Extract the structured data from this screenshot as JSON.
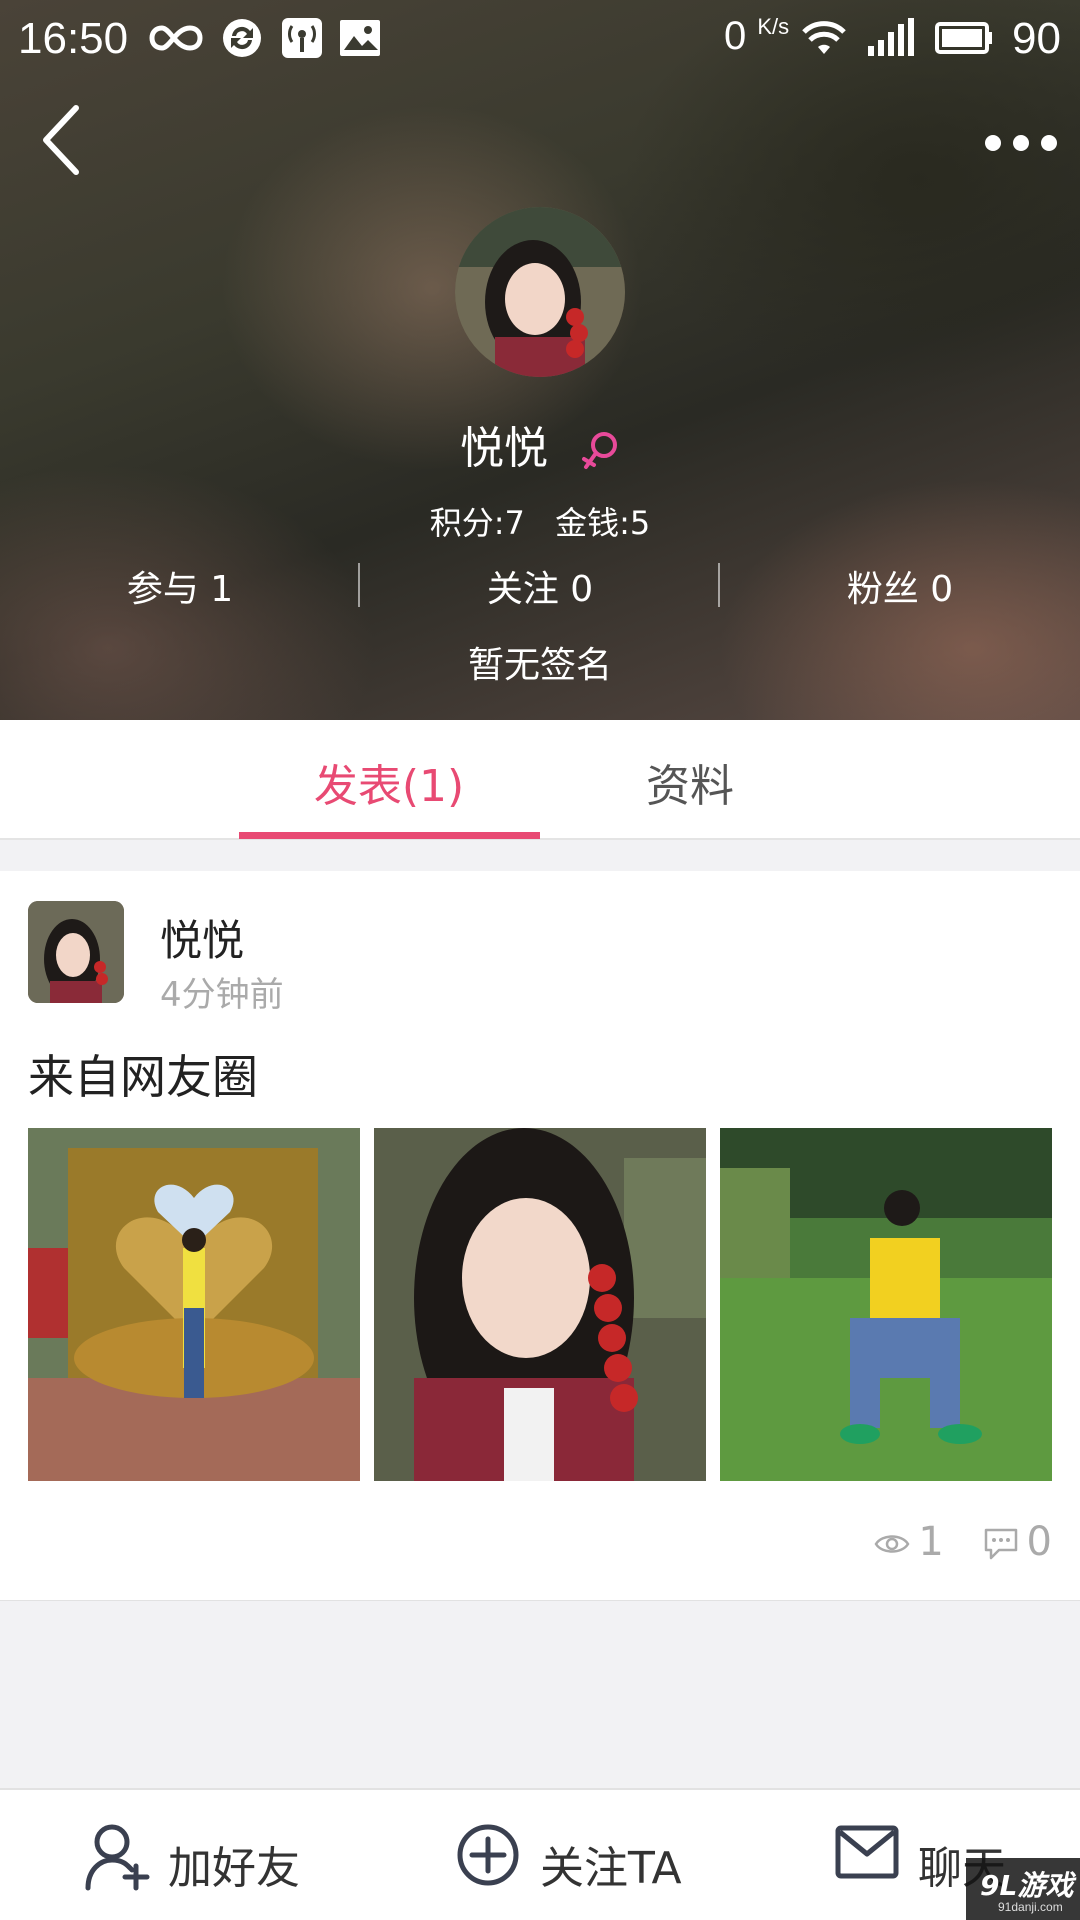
{
  "status_bar": {
    "time": "16:50",
    "net_speed": "0",
    "net_unit": "K/s",
    "battery": "90",
    "icons": [
      "infinity-icon",
      "sync-icon",
      "hotspot-icon",
      "image-icon",
      "wifi-icon",
      "signal-icon",
      "battery-icon"
    ]
  },
  "header": {
    "back_icon": "chevron-left-icon",
    "more_icon": "more-dots-icon",
    "user_name": "悦悦",
    "gender_icon": "female-icon",
    "gender_color": "#e84a9a",
    "points_label": "积分:7",
    "money_label": "金钱:5",
    "stats": [
      {
        "label": "参与 1"
      },
      {
        "label": "关注 0"
      },
      {
        "label": "粉丝 0"
      }
    ],
    "signature": "暂无签名"
  },
  "tabs": [
    {
      "label": "发表(1)",
      "active": true
    },
    {
      "label": "资料",
      "active": false
    }
  ],
  "accent_color": "#e84a73",
  "post": {
    "author": "悦悦",
    "time": "4分钟前",
    "text": "来自网友圈",
    "views": "1",
    "comments": "0"
  },
  "bottom_bar": {
    "add_friend": "加好友",
    "follow": "关注TA",
    "chat": "聊天"
  },
  "watermark": {
    "main": "9L游戏",
    "sub": "91danji.com"
  }
}
